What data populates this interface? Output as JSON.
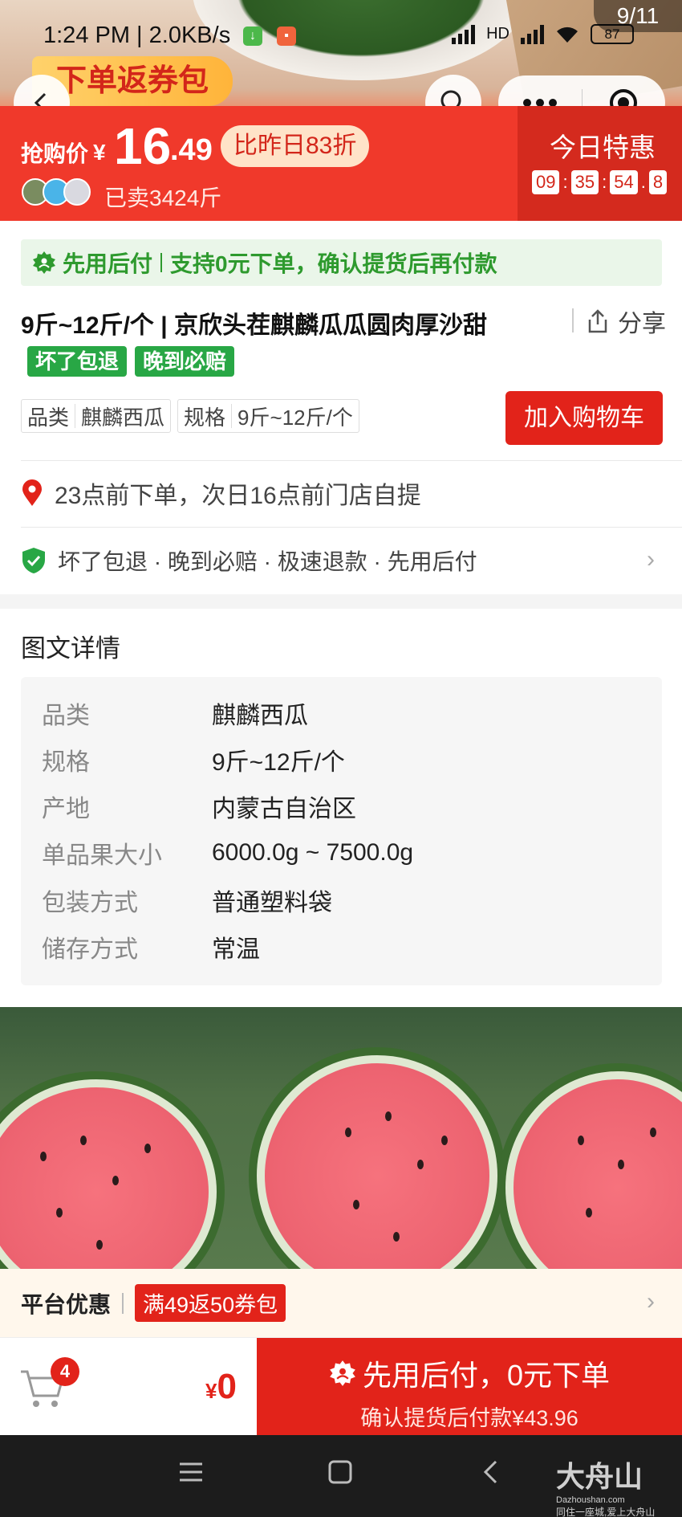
{
  "status_bar": {
    "time": "1:24 PM | 2.0KB/s",
    "battery": "87",
    "network": "HD",
    "page_counter": "9/11"
  },
  "hero": {
    "coupon_tag": "下单返券包",
    "price_label": "抢购价",
    "currency": "¥",
    "price_int": "16",
    "price_dec": ".49",
    "discount": "比昨日83折",
    "sold": "已卖3424斤",
    "deal_title": "今日特惠",
    "timer": [
      "09",
      "35",
      "54",
      "8"
    ]
  },
  "paylater": {
    "label": "先用后付",
    "desc": "支持0元下单，确认提货后再付款"
  },
  "product": {
    "title": "9斤~12斤/个 | 京欣头茬麒麟瓜瓜圆肉厚沙甜",
    "share": "分享",
    "tags": [
      "坏了包退",
      "晚到必赔"
    ],
    "spec_category_label": "品类",
    "spec_category_value": "麒麟西瓜",
    "spec_size_label": "规格",
    "spec_size_value": "9斤~12斤/个",
    "add_cart": "加入购物车"
  },
  "pickup": "23点前下单，次日16点前门店自提",
  "service": "坏了包退 · 晚到必赔 · 极速退款 · 先用后付",
  "details": {
    "title": "图文详情",
    "rows": [
      {
        "k": "品类",
        "v": "麒麟西瓜"
      },
      {
        "k": "规格",
        "v": "9斤~12斤/个"
      },
      {
        "k": "产地",
        "v": "内蒙古自治区"
      },
      {
        "k": "单品果大小",
        "v": "6000.0g ~ 7500.0g"
      },
      {
        "k": "包装方式",
        "v": "普通塑料袋"
      },
      {
        "k": "储存方式",
        "v": "常温"
      }
    ]
  },
  "promo": {
    "label": "平台优惠",
    "badge": "满49返50券包"
  },
  "bottom_bar": {
    "cart_count": "4",
    "currency": "¥",
    "total": "0",
    "checkout_line1": "先用后付，0元下单",
    "checkout_line2": "确认提货后付款¥43.96"
  },
  "watermark": {
    "name": "大舟山",
    "domain": "Dazhoushan.com",
    "slogan": "同住一座城,爱上大舟山"
  },
  "colors": {
    "brand_red": "#e2231a",
    "banner_red": "#f0392b",
    "green": "#28a745"
  }
}
